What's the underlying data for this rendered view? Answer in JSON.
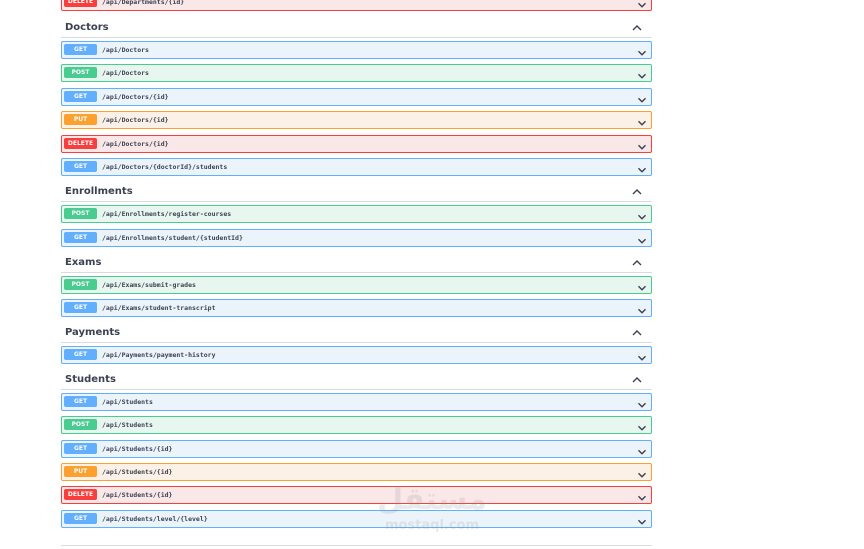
{
  "sections": [
    {
      "name": "",
      "collapsed": false,
      "ops": [
        {
          "method": "DELETE",
          "path": "/api/Departments/{id}"
        }
      ]
    },
    {
      "name": "Doctors",
      "collapsed": false,
      "ops": [
        {
          "method": "GET",
          "path": "/api/Doctors"
        },
        {
          "method": "POST",
          "path": "/api/Doctors"
        },
        {
          "method": "GET",
          "path": "/api/Doctors/{id}"
        },
        {
          "method": "PUT",
          "path": "/api/Doctors/{id}"
        },
        {
          "method": "DELETE",
          "path": "/api/Doctors/{id}"
        },
        {
          "method": "GET",
          "path": "/api/Doctors/{doctorId}/students"
        }
      ]
    },
    {
      "name": "Enrollments",
      "collapsed": false,
      "ops": [
        {
          "method": "POST",
          "path": "/api/Enrollments/register-courses"
        },
        {
          "method": "GET",
          "path": "/api/Enrollments/student/{studentId}"
        }
      ]
    },
    {
      "name": "Exams",
      "collapsed": false,
      "ops": [
        {
          "method": "POST",
          "path": "/api/Exams/submit-grades"
        },
        {
          "method": "GET",
          "path": "/api/Exams/student-transcript"
        }
      ]
    },
    {
      "name": "Payments",
      "collapsed": false,
      "ops": [
        {
          "method": "GET",
          "path": "/api/Payments/payment-history"
        }
      ]
    },
    {
      "name": "Students",
      "collapsed": false,
      "ops": [
        {
          "method": "GET",
          "path": "/api/Students"
        },
        {
          "method": "POST",
          "path": "/api/Students"
        },
        {
          "method": "GET",
          "path": "/api/Students/{id}"
        },
        {
          "method": "PUT",
          "path": "/api/Students/{id}"
        },
        {
          "method": "DELETE",
          "path": "/api/Students/{id}"
        },
        {
          "method": "GET",
          "path": "/api/Students/level/{level}"
        }
      ]
    }
  ],
  "watermark": {
    "arabic": "مستقل",
    "latin": "mostaql.com"
  },
  "icons": {
    "collapse": "chevron-up-icon",
    "expand": "chevron-down-icon"
  },
  "colors": {
    "get": "#61affe",
    "post": "#49cc90",
    "put": "#fca130",
    "delete": "#f93e3e"
  }
}
